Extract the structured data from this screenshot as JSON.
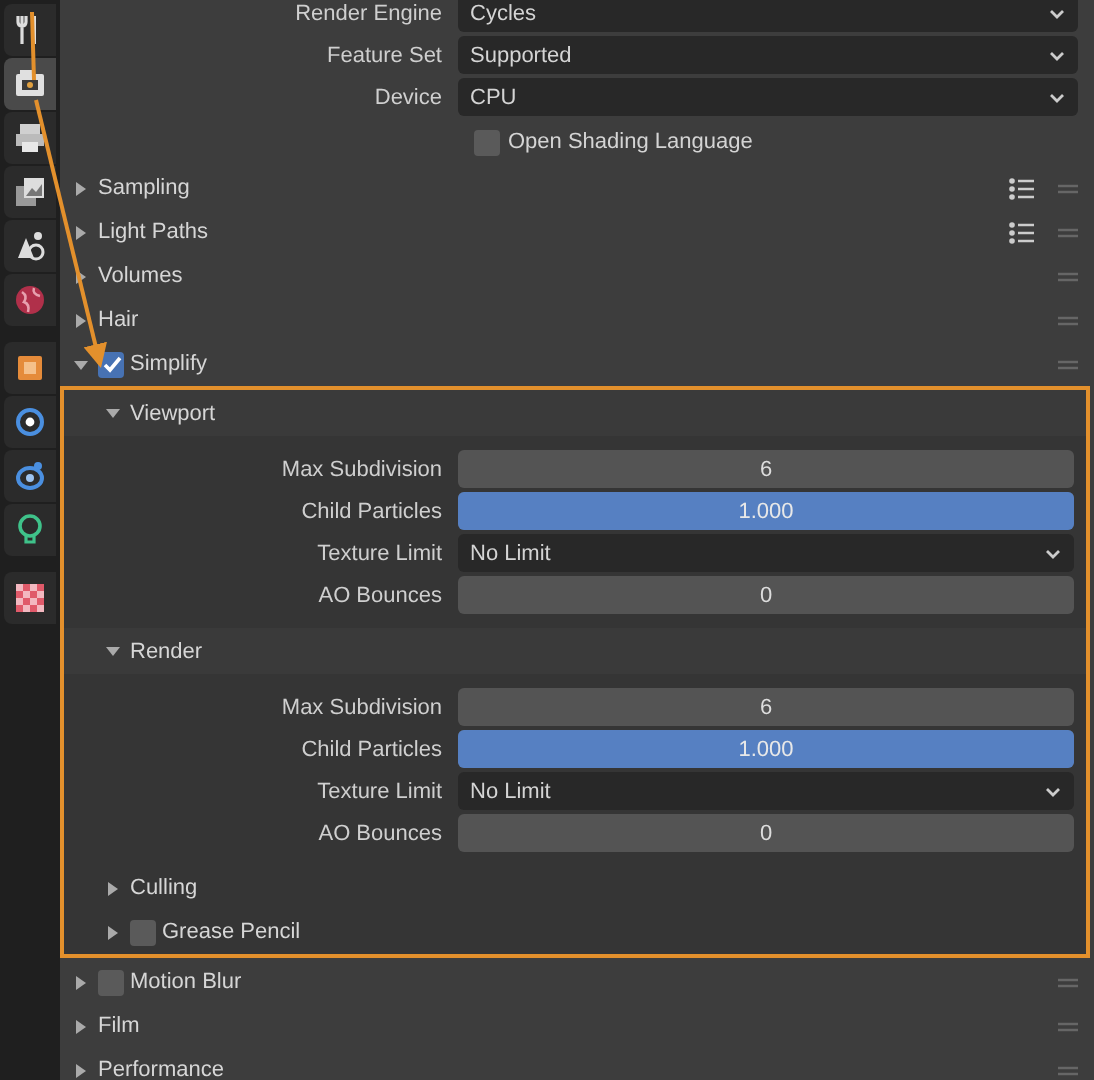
{
  "sidebar_tabs": [
    {
      "kind": "tool",
      "selected": false
    },
    {
      "kind": "render",
      "selected": true
    },
    {
      "kind": "output",
      "selected": false
    },
    {
      "kind": "view_layer",
      "selected": false
    },
    {
      "kind": "scene",
      "selected": false
    },
    {
      "kind": "world",
      "selected": false
    },
    {
      "kind": "object",
      "selected": false
    },
    {
      "kind": "physics",
      "selected": false
    },
    {
      "kind": "constraints",
      "selected": false
    },
    {
      "kind": "light_data",
      "selected": false
    },
    {
      "kind": "texture",
      "selected": false
    }
  ],
  "settings": [
    {
      "label": "Render Engine",
      "kind": "dropdown",
      "value": "Cycles"
    },
    {
      "label": "Feature Set",
      "kind": "dropdown",
      "value": "Supported"
    },
    {
      "label": "Device",
      "kind": "dropdown",
      "value": "CPU"
    }
  ],
  "open_shading_language": {
    "label": "Open Shading Language",
    "checked": false
  },
  "panels": [
    {
      "title": "Sampling",
      "kind": "plain",
      "expanded": false,
      "presets": true
    },
    {
      "title": "Light Paths",
      "kind": "plain",
      "expanded": false,
      "presets": true
    },
    {
      "title": "Volumes",
      "kind": "plain",
      "expanded": false,
      "presets": false
    },
    {
      "title": "Hair",
      "kind": "plain",
      "expanded": false,
      "presets": false
    },
    {
      "title": "Simplify",
      "kind": "checkbox",
      "checked": true,
      "expanded": true,
      "presets": false,
      "highlighted": true,
      "subpanels": [
        {
          "title": "Viewport",
          "kind": "plain",
          "expanded": true,
          "rows": [
            {
              "label": "Max Subdivision",
              "kind": "number",
              "value": "6"
            },
            {
              "label": "Child Particles",
              "kind": "slider",
              "value": "1.000",
              "level": 1
            },
            {
              "label": "Texture Limit",
              "kind": "dropdown",
              "value": "No Limit"
            },
            {
              "label": "AO Bounces",
              "kind": "number",
              "value": "0"
            }
          ]
        },
        {
          "title": "Render",
          "kind": "plain",
          "expanded": true,
          "rows": [
            {
              "label": "Max Subdivision",
              "kind": "number",
              "value": "6"
            },
            {
              "label": "Child Particles",
              "kind": "slider",
              "value": "1.000",
              "level": 1
            },
            {
              "label": "Texture Limit",
              "kind": "dropdown",
              "value": "No Limit"
            },
            {
              "label": "AO Bounces",
              "kind": "number",
              "value": "0"
            }
          ]
        },
        {
          "title": "Culling",
          "kind": "plain",
          "expanded": false
        },
        {
          "title": "Grease Pencil",
          "kind": "checkbox",
          "checked": false,
          "expanded": false
        }
      ]
    },
    {
      "title": "Motion Blur",
      "kind": "checkbox",
      "checked": false,
      "expanded": false,
      "presets": false
    },
    {
      "title": "Film",
      "kind": "plain",
      "expanded": false,
      "presets": false
    },
    {
      "title": "Performance",
      "kind": "plain",
      "expanded": false,
      "presets": false
    }
  ]
}
